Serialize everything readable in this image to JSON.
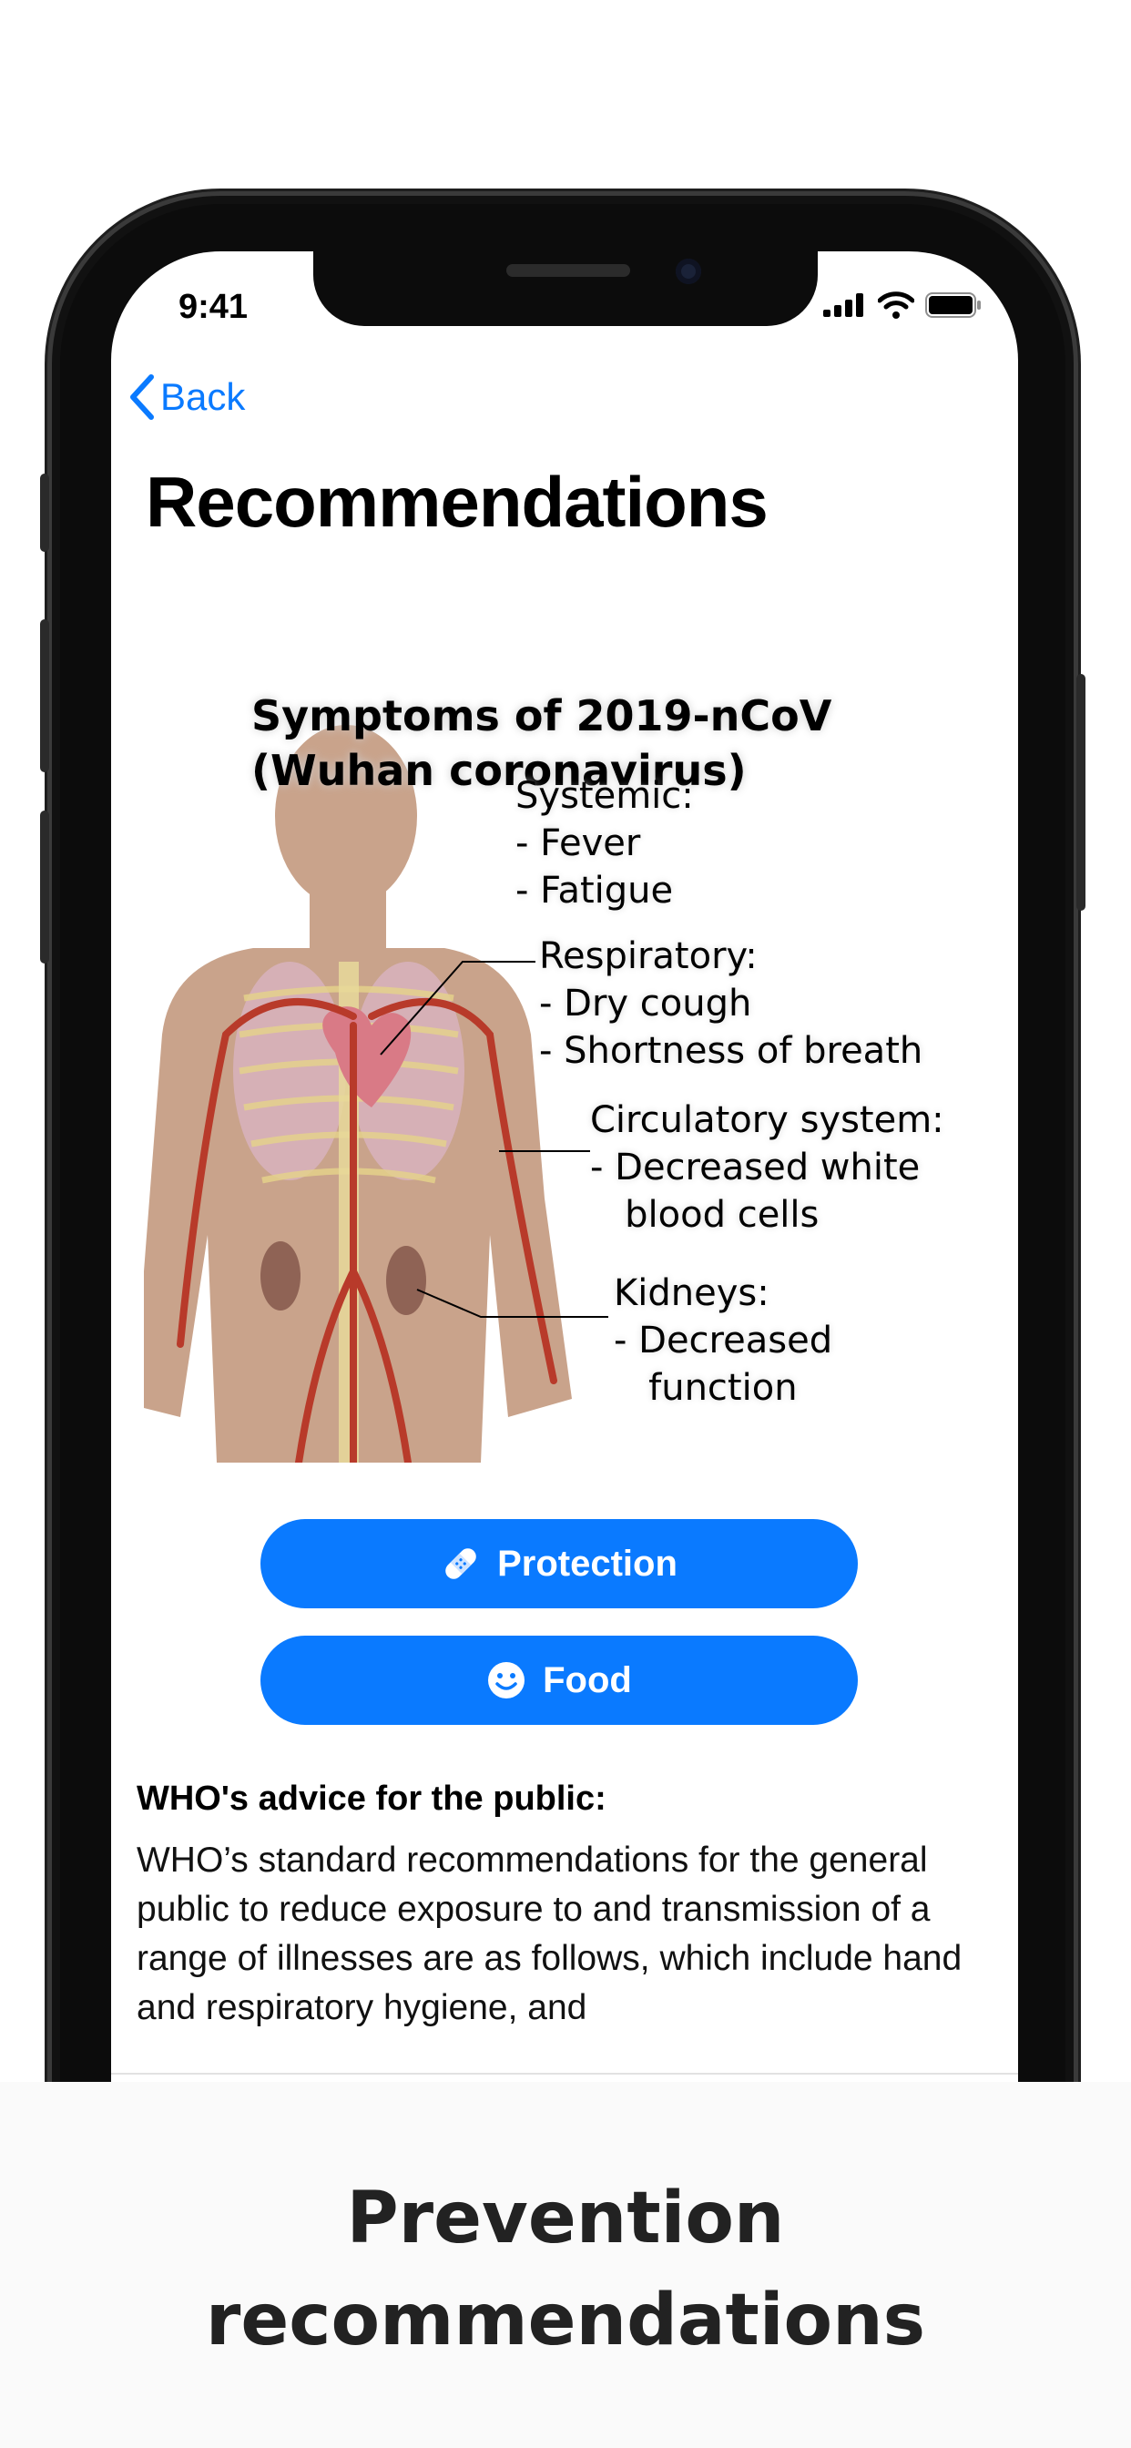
{
  "status_bar": {
    "time": "9:41"
  },
  "nav": {
    "back_label": "Back"
  },
  "page": {
    "title": "Recommendations"
  },
  "infographic": {
    "title": "Symptoms of 2019-nCoV\n(Wuhan coronavirus)",
    "systemic": "Systemic:\n- Fever\n- Fatigue",
    "respiratory": "Respiratory:\n- Dry cough\n- Shortness of breath",
    "circulatory": "Circulatory system:\n- Decreased white\n   blood cells",
    "kidneys": "Kidneys:\n- Decreased\n   function"
  },
  "buttons": {
    "protection_label": "Protection",
    "food_label": "Food"
  },
  "advice": {
    "heading": "WHO's advice for the public:",
    "body": "WHO’s standard recommendations for the general public to reduce exposure to and transmission of a range of illnesses are as follows, which include hand and respiratory hygiene, and"
  },
  "caption": {
    "text": "Prevention\nrecommendations"
  },
  "colors": {
    "accent": "#0a7aff",
    "skin": "#c9a38b",
    "artery": "#c0392b"
  },
  "icons": [
    "back-chevron-icon",
    "signal-icon",
    "wifi-icon",
    "battery-icon",
    "bandage-icon",
    "smiley-icon"
  ]
}
